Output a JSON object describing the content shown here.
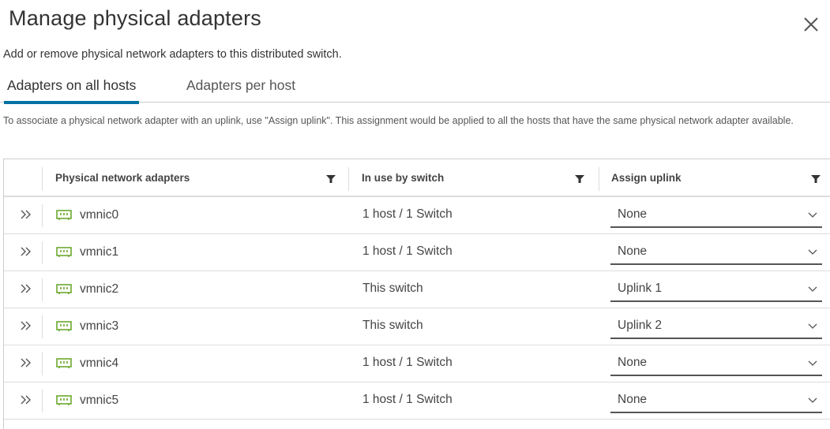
{
  "dialog": {
    "title": "Manage physical adapters",
    "subtitle": "Add or remove physical network adapters to this distributed switch.",
    "close_icon": "close-icon"
  },
  "tabs": [
    {
      "label": "Adapters on all hosts",
      "active": true
    },
    {
      "label": "Adapters per host",
      "active": false
    }
  ],
  "info_text": "To associate a physical network adapter with an uplink, use \"Assign uplink\". This assignment would be applied to all the hosts that have the same physical network adapter available.",
  "colors": {
    "accent": "#0072a3",
    "nic_icon": "#62a420",
    "text": "#333333",
    "border": "#dddddd"
  },
  "grid": {
    "columns": [
      {
        "label": "Physical network adapters",
        "filter_icon": "filter-icon"
      },
      {
        "label": "In use by switch",
        "filter_icon": "filter-icon"
      },
      {
        "label": "Assign uplink",
        "filter_icon": "filter-icon"
      }
    ],
    "rows": [
      {
        "adapter": "vmnic0",
        "in_use": "1 host / 1 Switch",
        "uplink": "None"
      },
      {
        "adapter": "vmnic1",
        "in_use": "1 host / 1 Switch",
        "uplink": "None"
      },
      {
        "adapter": "vmnic2",
        "in_use": "This switch",
        "uplink": "Uplink 1"
      },
      {
        "adapter": "vmnic3",
        "in_use": "This switch",
        "uplink": "Uplink 2"
      },
      {
        "adapter": "vmnic4",
        "in_use": "1 host / 1 Switch",
        "uplink": "None"
      },
      {
        "adapter": "vmnic5",
        "in_use": "1 host / 1 Switch",
        "uplink": "None"
      }
    ]
  }
}
